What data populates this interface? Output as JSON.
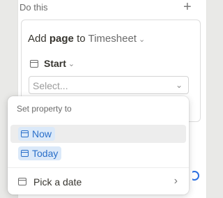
{
  "panel": {
    "title": "Do this",
    "add_icon": "plus-icon"
  },
  "action": {
    "verb": "Add",
    "object": "page",
    "preposition": "to",
    "database": "Timesheet",
    "property_label": "Start",
    "select_placeholder": "Select..."
  },
  "dropdown": {
    "heading": "Set property to",
    "options": [
      {
        "label": "Now",
        "icon": "calendar-icon"
      },
      {
        "label": "Today",
        "icon": "calendar-icon"
      }
    ],
    "pick_label": "Pick a date"
  },
  "colors": {
    "chip_bg": "#dbe9f9",
    "chip_text": "#2a6fc9",
    "toggle": "#2b6fe0"
  }
}
